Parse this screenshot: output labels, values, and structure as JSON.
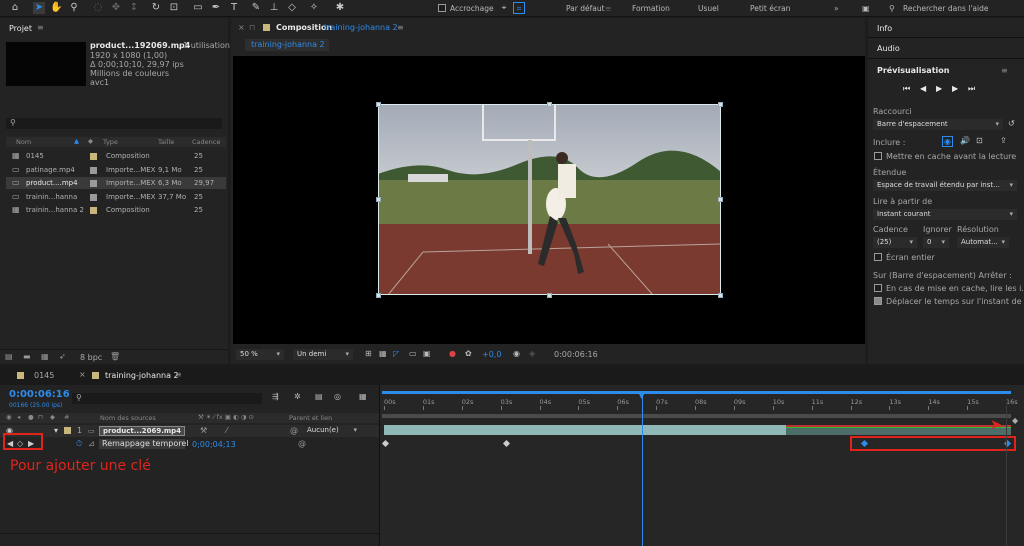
{
  "toolbar": {
    "accrochage": "Accrochage",
    "workspaces": [
      "Par défaut",
      "Formation",
      "Usuel",
      "Petit écran"
    ],
    "search_placeholder": "Rechercher dans l'aide"
  },
  "project": {
    "title": "Projet",
    "asset_name": "product...192069.mp4",
    "asset_usage": ", 1 utilisation",
    "asset_details": [
      "1920 x 1080 (1,00)",
      "Δ 0;00;10;10, 29,97 ips",
      "Millions de couleurs",
      "avc1"
    ],
    "columns": {
      "name": "Nom",
      "type": "Type",
      "size": "Taille",
      "rate": "Cadence"
    },
    "items": [
      {
        "name": "0145",
        "type": "Composition",
        "size": "",
        "rate": "25",
        "kind": "comp"
      },
      {
        "name": "patinage.mp4",
        "type": "Importe...MEX",
        "size": "9,1 Mo",
        "rate": "25",
        "kind": "footage"
      },
      {
        "name": "product....mp4",
        "type": "Importe...MEX",
        "size": "6,3 Mo",
        "rate": "29,97",
        "kind": "footage"
      },
      {
        "name": "trainin...hanna",
        "type": "Importe...MEX",
        "size": "37,7 Mo",
        "rate": "25",
        "kind": "footage"
      },
      {
        "name": "trainin...hanna 2",
        "type": "Composition",
        "size": "",
        "rate": "25",
        "kind": "comp"
      }
    ],
    "bpc": "8 bpc"
  },
  "composition": {
    "tab_prefix": "Composition",
    "tab_name": "training-johanna 2",
    "breadcrumb": "training-johanna 2",
    "zoom": "50 %",
    "resolution": "Un demi",
    "exposure": "+0,0",
    "timecode": "0:00:06:16"
  },
  "right": {
    "info": "Info",
    "audio": "Audio",
    "preview_title": "Prévisualisation",
    "raccourci_label": "Raccourci",
    "raccourci_value": "Barre d'espacement",
    "inclure_label": "Inclure :",
    "cache_label": "Mettre en cache avant la lecture",
    "etendue_label": "Étendue",
    "etendue_value": "Espace de travail étendu par inst...",
    "lire_label": "Lire à partir de",
    "lire_value": "Instant courant",
    "cadence_label": "Cadence",
    "ignorer_label": "Ignorer",
    "resolution_label": "Résolution",
    "cadence_value": "(25)",
    "ignorer_value": "0",
    "resolution_value": "Automat...",
    "ecran_label": "Écran entier",
    "sur_label": "Sur (Barre d'espacement) Arrêter :",
    "cache2_label": "En cas de mise en cache, lire les i...",
    "move_label": "Déplacer le temps sur l'instant de pré"
  },
  "timeline": {
    "tabs": [
      "0145",
      "training-johanna 2"
    ],
    "timecode": "0:00:06:16",
    "frame_info": "00166 (25.00 ips)",
    "col_sources": "Nom des sources",
    "col_parent": "Parent et lien",
    "layer_num": "1",
    "layer_name": "product...2069.mp4",
    "parent_value": "Aucun(e)",
    "property_name": "Remappage temporel",
    "property_value": "0;00;04;13",
    "ruler": [
      "00s",
      "01s",
      "02s",
      "03s",
      "04s",
      "05s",
      "06s",
      "07s",
      "08s",
      "09s",
      "10s",
      "11s",
      "12s",
      "13s",
      "14s",
      "15s",
      "16s"
    ],
    "playhead_seconds": 6.64,
    "duration_seconds": 16,
    "annotation": "Pour ajouter une clé"
  },
  "colors": {
    "accent": "#2d8ceb",
    "annotation_red": "#e0241c",
    "layer_bar": "#8fb9b9"
  }
}
